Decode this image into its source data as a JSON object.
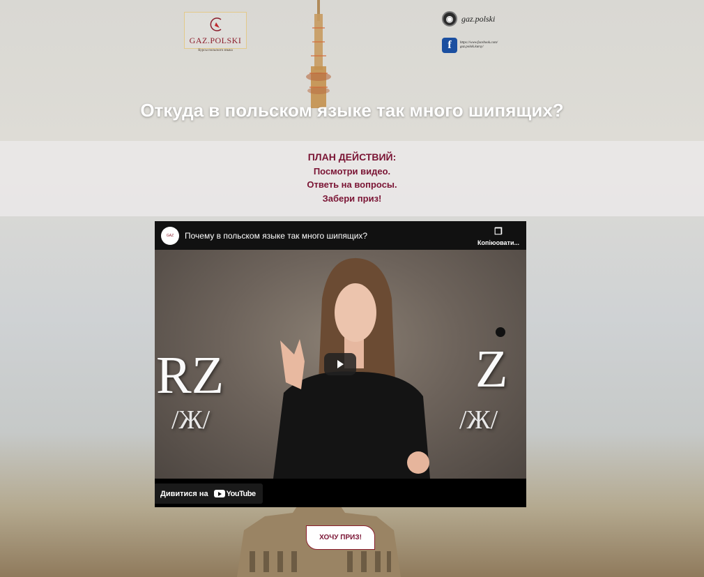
{
  "header": {
    "logo": {
      "brand": "GAZ.POLSKI",
      "subtitle": "Курсы польского языка"
    },
    "social": {
      "instagram": {
        "icon": "instagram-icon",
        "label": "gaz.polski"
      },
      "facebook": {
        "icon": "facebook-icon",
        "label": "https://www.facebook.com/ gaz.polski.kursy/"
      }
    }
  },
  "main": {
    "headline": "Откуда в польском языке так много шипящих?",
    "plan": {
      "title": "ПЛАН ДЕЙСТВИЙ:",
      "steps": [
        "Посмотри видео.",
        "Ответь на вопросы.",
        "Забери приз!"
      ]
    },
    "video": {
      "title": "Почему в польском языке так много шипящих?",
      "copy_label": "Копіюовати...",
      "overlay_left_top": "RZ",
      "overlay_left_bottom": "/Ж/",
      "overlay_right_top": "Z",
      "overlay_right_bottom": "/Ж/",
      "watch_on_label": "Дивитися на",
      "youtube_label": "YouTube"
    },
    "cta_label": "ХОЧУ ПРИЗ!"
  },
  "colors": {
    "accent": "#7a1434",
    "video_bg": "#000000",
    "plan_bg": "#ece9e9"
  }
}
